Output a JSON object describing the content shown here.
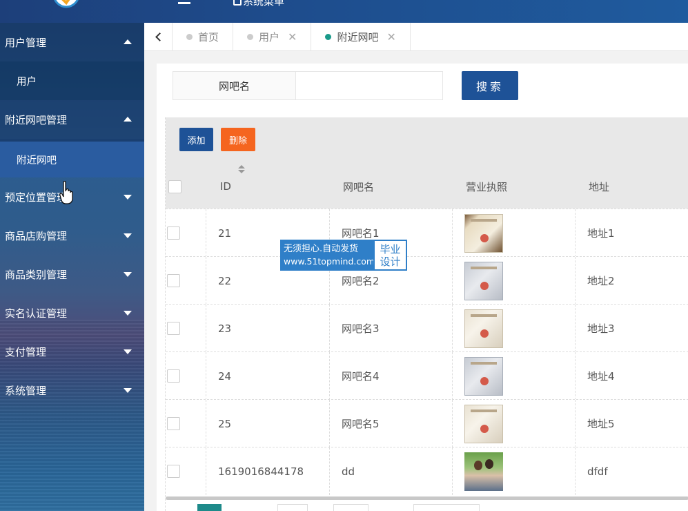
{
  "header": {
    "menu_label": "系统菜单"
  },
  "sidebar": {
    "items": [
      {
        "label": "用户管理",
        "expanded": true
      },
      {
        "label": "用户",
        "sub": true
      },
      {
        "label": "附近网吧管理",
        "expanded": true
      },
      {
        "label": "附近网吧",
        "sub": true,
        "active": true
      },
      {
        "label": "预定位置管理"
      },
      {
        "label": "商品店购管理"
      },
      {
        "label": "商品类别管理"
      },
      {
        "label": "实名认证管理"
      },
      {
        "label": "支付管理"
      },
      {
        "label": "系统管理"
      }
    ]
  },
  "tabs": [
    {
      "label": "首页"
    },
    {
      "label": "用户"
    },
    {
      "label": "附近网吧",
      "active": true
    }
  ],
  "search": {
    "label": "网吧名",
    "value": "",
    "button": "搜索"
  },
  "toolbar": {
    "add": "添加",
    "delete": "删除"
  },
  "table": {
    "columns": [
      "ID",
      "网吧名",
      "营业执照",
      "地址"
    ],
    "rows": [
      {
        "id": "21",
        "name": "网吧名1",
        "address": "地址1"
      },
      {
        "id": "22",
        "name": "网吧名2",
        "address": "地址2"
      },
      {
        "id": "23",
        "name": "网吧名3",
        "address": "地址3"
      },
      {
        "id": "24",
        "name": "网吧名4",
        "address": "地址4"
      },
      {
        "id": "25",
        "name": "网吧名5",
        "address": "地址5"
      },
      {
        "id": "1619016844178",
        "name": "dd",
        "address": "dfdf"
      }
    ]
  },
  "watermark": {
    "line1": "无须担心.自动发货",
    "line2": "www.51topmind.com",
    "right1": "毕业",
    "right2": "设计"
  },
  "colors": {
    "primary": "#1e5297",
    "danger": "#f5651f",
    "tab_active_dot": "#1a9a8a"
  }
}
